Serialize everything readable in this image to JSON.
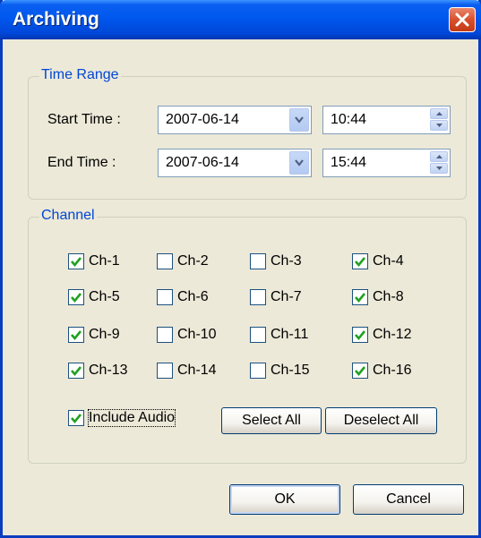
{
  "window": {
    "title": "Archiving"
  },
  "time_range": {
    "group_label": "Time Range",
    "start": {
      "label": "Start Time :",
      "date": "2007-06-14",
      "time": "10:44"
    },
    "end": {
      "label": "End Time :",
      "date": "2007-06-14",
      "time": "15:44"
    }
  },
  "channel": {
    "group_label": "Channel",
    "items": [
      {
        "label": "Ch-1",
        "checked": true
      },
      {
        "label": "Ch-2",
        "checked": false
      },
      {
        "label": "Ch-3",
        "checked": false
      },
      {
        "label": "Ch-4",
        "checked": true
      },
      {
        "label": "Ch-5",
        "checked": true
      },
      {
        "label": "Ch-6",
        "checked": false
      },
      {
        "label": "Ch-7",
        "checked": false
      },
      {
        "label": "Ch-8",
        "checked": true
      },
      {
        "label": "Ch-9",
        "checked": true
      },
      {
        "label": "Ch-10",
        "checked": false
      },
      {
        "label": "Ch-11",
        "checked": false
      },
      {
        "label": "Ch-12",
        "checked": true
      },
      {
        "label": "Ch-13",
        "checked": true
      },
      {
        "label": "Ch-14",
        "checked": false
      },
      {
        "label": "Ch-15",
        "checked": false
      },
      {
        "label": "Ch-16",
        "checked": true
      }
    ],
    "include_audio": {
      "label": "Include Audio",
      "checked": true
    },
    "select_all_label": "Select All",
    "deselect_all_label": "Deselect All"
  },
  "footer": {
    "ok_label": "OK",
    "cancel_label": "Cancel"
  },
  "colors": {
    "title_bar": "#0058EE",
    "group_label": "#0046D5",
    "check": "#21A121",
    "close": "#D8502C"
  },
  "icons": {
    "close": "close-icon",
    "dropdown": "chevron-down-icon",
    "spin_up": "spin-up-icon",
    "spin_down": "spin-down-icon",
    "check": "check-icon"
  }
}
